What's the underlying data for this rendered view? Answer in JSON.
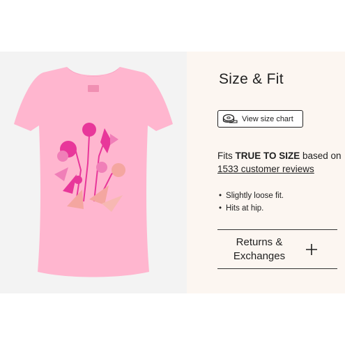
{
  "size_fit": {
    "title": "Size & Fit",
    "size_chart_button": "View size chart",
    "fits_prefix": "Fits ",
    "fits_emphasis": "TRUE TO SIZE",
    "fits_suffix": " based on ",
    "reviews_link": "1533 customer reviews",
    "bullets": [
      "Slightly loose fit.",
      "Hits at hip."
    ]
  },
  "accordion": {
    "returns_label_line1": "Returns &",
    "returns_label_line2": "Exchanges"
  },
  "product": {
    "shirt_color": "#ffb6cf",
    "print_colors": [
      "#e8379a",
      "#f07fb8",
      "#f4a6a0"
    ]
  },
  "icons": {
    "size_chart": "tape-measure-icon",
    "expand": "plus-icon"
  }
}
